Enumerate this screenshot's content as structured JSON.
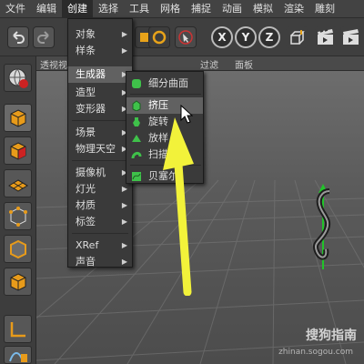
{
  "menubar": {
    "items": [
      {
        "label": "文件"
      },
      {
        "label": "编辑"
      },
      {
        "label": "创建"
      },
      {
        "label": "选择"
      },
      {
        "label": "工具"
      },
      {
        "label": "网格"
      },
      {
        "label": "捕捉"
      },
      {
        "label": "动画"
      },
      {
        "label": "模拟"
      },
      {
        "label": "渲染"
      },
      {
        "label": "雕刻"
      }
    ]
  },
  "toolbar": {
    "axis_x": "X",
    "axis_y": "Y",
    "axis_z": "Z"
  },
  "viewport_header": {
    "left_label": "透视视",
    "filter_label": "过滤",
    "panel_label": "面板"
  },
  "create_menu": {
    "items": [
      {
        "label": "对象",
        "submenu": true
      },
      {
        "label": "样条",
        "submenu": true
      },
      {
        "label": "生成器",
        "submenu": true
      },
      {
        "label": "造型",
        "submenu": true
      },
      {
        "label": "变形器",
        "submenu": true
      },
      {
        "label": "场景",
        "submenu": true
      },
      {
        "label": "物理天空",
        "submenu": true
      },
      {
        "label": "摄像机",
        "submenu": true
      },
      {
        "label": "灯光",
        "submenu": true
      },
      {
        "label": "材质",
        "submenu": true
      },
      {
        "label": "标签",
        "submenu": true
      },
      {
        "label": "XRef",
        "submenu": true
      },
      {
        "label": "声音",
        "submenu": true
      }
    ]
  },
  "generator_submenu": {
    "items": [
      {
        "label": "细分曲面"
      },
      {
        "label": "挤压"
      },
      {
        "label": "旋转"
      },
      {
        "label": "放样"
      },
      {
        "label": "扫描"
      },
      {
        "label": "贝塞尔"
      }
    ]
  },
  "colors": {
    "arrow": "#f2f23a",
    "highlight": "#616161",
    "axis_y": "#22c32a"
  },
  "watermark": {
    "brand": "搜狗指南",
    "url": "zhinan.sogou.com"
  }
}
